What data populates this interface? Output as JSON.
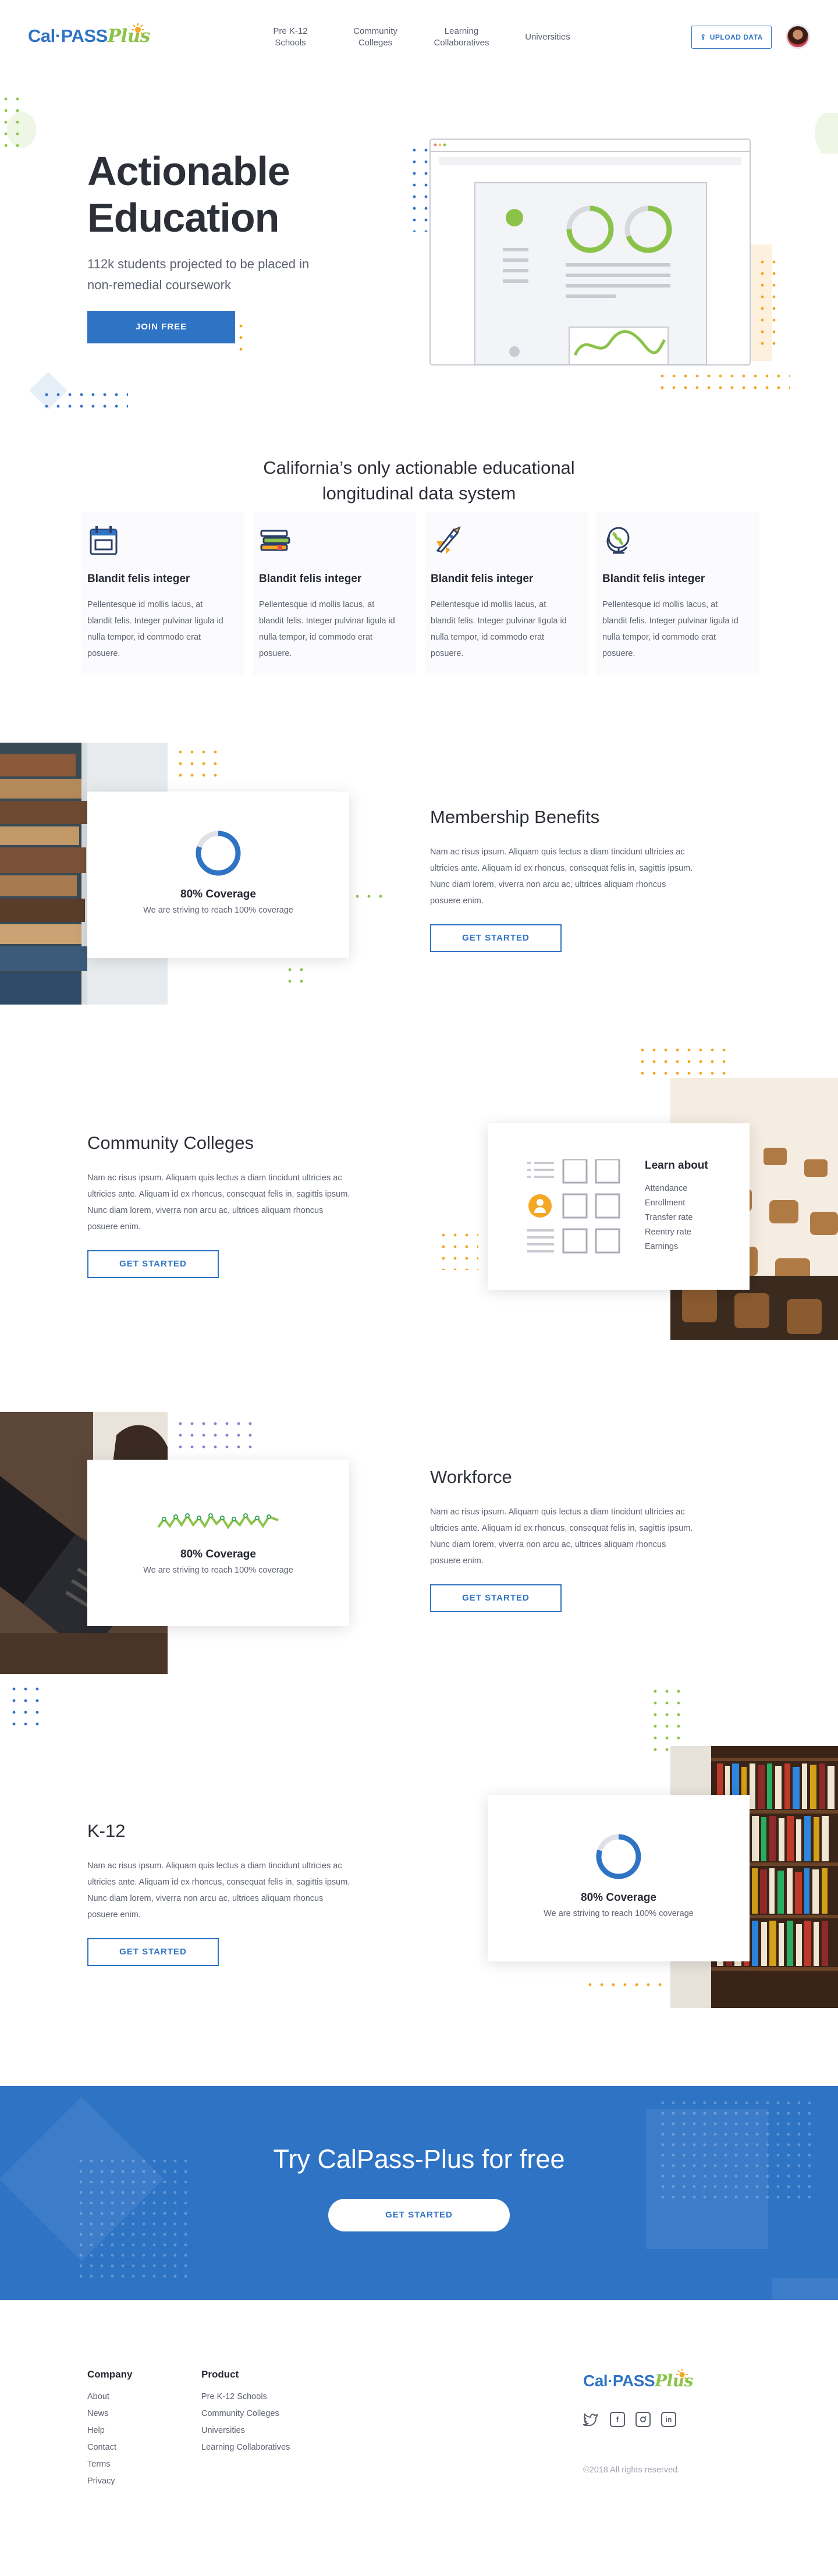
{
  "header": {
    "logo_cal": "Cal·PASS",
    "logo_plus": "Plus",
    "nav": [
      {
        "line1": "Pre K-12",
        "line2": "Schools"
      },
      {
        "line1": "Community",
        "line2": "Colleges"
      },
      {
        "line1": "Learning",
        "line2": "Collaboratives"
      },
      {
        "line1": "Universities",
        "line2": ""
      }
    ],
    "upload_label": "UPLOAD DATA"
  },
  "hero": {
    "title_line1": "Actionable",
    "title_line2": "Education",
    "subtitle_line1": "112k students projected to be placed in",
    "subtitle_line2": "non-remedial coursework",
    "cta": "JOIN FREE"
  },
  "intro": {
    "title_line1": "California’s only actionable educational",
    "title_line2": "longitudinal data system"
  },
  "features": [
    {
      "icon": "calendar-icon",
      "title": "Blandit felis integer",
      "body": "Pellentesque id mollis lacus, at blandit felis. Integer pulvinar ligula id nulla tempor, id commodo erat posuere."
    },
    {
      "icon": "books-icon",
      "title": "Blandit felis integer",
      "body": "Pellentesque id mollis lacus, at blandit felis. Integer pulvinar ligula id nulla tempor, id commodo erat posuere."
    },
    {
      "icon": "rocket-icon",
      "title": "Blandit felis integer",
      "body": "Pellentesque id mollis lacus, at blandit felis. Integer pulvinar ligula id nulla tempor, id commodo erat posuere."
    },
    {
      "icon": "globe-icon",
      "title": "Blandit felis integer",
      "body": "Pellentesque id mollis lacus, at blandit felis. Integer pulvinar ligula id nulla tempor, id commodo erat posuere."
    }
  ],
  "membership": {
    "coverage_title": "80% Coverage",
    "coverage_sub": "We are striving to reach 100% coverage",
    "coverage_pct": 80,
    "title": "Membership Benefits",
    "body": "Nam ac risus ipsum. Aliquam quis lectus a diam tincidunt ultricies ac ultricies ante. Aliquam id ex rhoncus, consequat felis in, sagittis ipsum. Nunc diam lorem, viverra non arcu ac, ultrices aliquam rhoncus posuere enim.",
    "cta": "GET STARTED"
  },
  "community": {
    "title": "Community Colleges",
    "body": "Nam ac risus ipsum. Aliquam quis lectus a diam tincidunt ultricies ac ultricies ante. Aliquam id ex rhoncus, consequat felis in, sagittis ipsum. Nunc diam lorem, viverra non arcu ac, ultrices aliquam rhoncus posuere enim.",
    "cta": "GET STARTED",
    "learn_title": "Learn about",
    "learn_items": [
      "Attendance",
      "Enrollment",
      "Transfer rate",
      "Reentry rate",
      "Earnings"
    ]
  },
  "workforce": {
    "coverage_title": "80% Coverage",
    "coverage_sub": "We are striving to reach 100% coverage",
    "title": "Workforce",
    "body": "Nam ac risus ipsum. Aliquam quis lectus a diam tincidunt ultricies ac ultricies ante. Aliquam id ex rhoncus, consequat felis in, sagittis ipsum. Nunc diam lorem, viverra non arcu ac, ultrices aliquam rhoncus posuere enim.",
    "cta": "GET STARTED"
  },
  "k12": {
    "title": "K-12",
    "body": "Nam ac risus ipsum. Aliquam quis lectus a diam tincidunt ultricies ac ultricies ante. Aliquam id ex rhoncus, consequat felis in, sagittis ipsum. Nunc diam lorem, viverra non arcu ac, ultrices aliquam rhoncus posuere enim.",
    "cta": "GET STARTED",
    "coverage_title": "80% Coverage",
    "coverage_sub": "We are striving to reach 100% coverage",
    "coverage_pct": 80
  },
  "try_banner": {
    "title": "Try CalPass-Plus for free",
    "cta": "GET STARTED"
  },
  "footer": {
    "company_heading": "Company",
    "company_links": [
      "About",
      "News",
      "Help",
      "Contact",
      "Terms",
      "Privacy"
    ],
    "product_heading": "Product",
    "product_links": [
      "Pre K-12 Schools",
      "Community Colleges",
      "Universities",
      "Learning Collaboratives"
    ],
    "logo_cal": "Cal·PASS",
    "logo_plus": "Plus",
    "social": [
      "twitter-icon",
      "facebook-icon",
      "instagram-icon",
      "linkedin-icon"
    ],
    "copyright": "©2018 All rights reserved."
  },
  "colors": {
    "brand_blue": "#2f73c4",
    "brand_green": "#8bc34a",
    "accent_orange": "#f5a623",
    "dark_text": "#2d2f38"
  }
}
